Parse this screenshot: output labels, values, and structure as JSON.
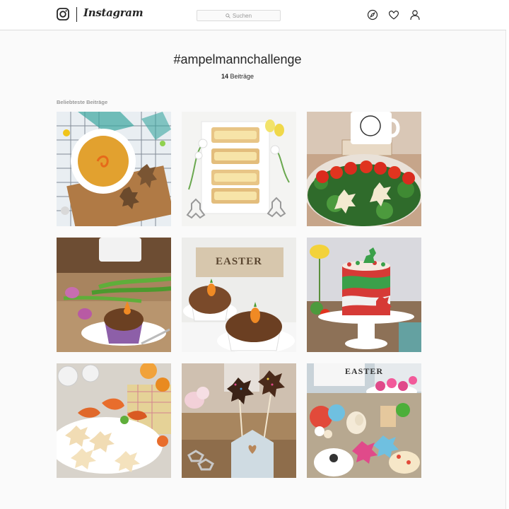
{
  "header": {
    "brand": "Instagram",
    "search_placeholder": "Suchen",
    "icons": [
      "instagram-logo-icon",
      "search-icon",
      "compass-icon",
      "heart-icon",
      "profile-icon"
    ]
  },
  "tag_page": {
    "hashtag": "#ampelmannchallenge",
    "post_count": "14",
    "post_label": "Beiträge",
    "section_title": "Beliebteste Beiträge"
  },
  "posts": [
    {
      "subject": "pumpkin soup with ampelmann crackers"
    },
    {
      "subject": "toast strips with flowers and cookie cutters"
    },
    {
      "subject": "tomato and broccoli salad with mug"
    },
    {
      "subject": "chocolate muffin with tulips"
    },
    {
      "subject": "carrot muffins",
      "sign_text": "EASTER"
    },
    {
      "subject": "layered ampelmann cake"
    },
    {
      "subject": "ampelmann cookies and pastries"
    },
    {
      "subject": "chocolate ampelmann pops in wooden house"
    },
    {
      "subject": "easter cupcakes table",
      "sign_text": "EASTER"
    }
  ],
  "colors": {
    "text": "#262626",
    "muted": "#999999",
    "border": "#dbdbdb",
    "background": "#fafafa"
  }
}
